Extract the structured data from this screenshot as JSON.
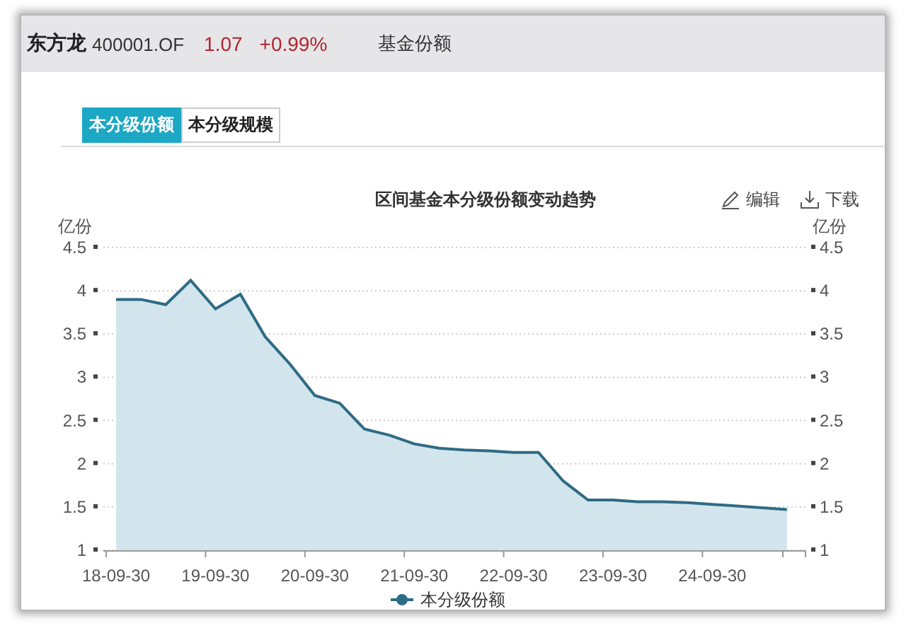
{
  "header": {
    "fund_name": "东方龙",
    "fund_code": "400001.OF",
    "price": "1.07",
    "change": "+0.99%",
    "section": "基金份额"
  },
  "tabs": [
    {
      "label": "本分级份额",
      "selected": true
    },
    {
      "label": "本分级规模",
      "selected": false
    }
  ],
  "chart_actions": [
    {
      "label": "编辑",
      "kind": "edit"
    },
    {
      "label": "下载",
      "kind": "download"
    }
  ],
  "chart_data": {
    "type": "area",
    "title": "区间基金本分级份额变动趋势",
    "ylabel": "亿份",
    "y2label": "亿份",
    "grid": true,
    "categories": [
      "18-09-30",
      null,
      null,
      null,
      "19-09-30",
      null,
      null,
      null,
      "20-09-30",
      null,
      null,
      null,
      "21-09-30",
      null,
      null,
      null,
      "22-09-30",
      null,
      null,
      null,
      "23-09-30",
      null,
      null,
      null,
      "24-09-30",
      null,
      null,
      null
    ],
    "series": [
      {
        "name": "本分级份额",
        "color": "#2e6b85",
        "values": [
          3.9,
          3.9,
          3.84,
          4.12,
          3.79,
          3.96,
          3.47,
          3.15,
          2.79,
          2.7,
          2.4,
          2.33,
          2.23,
          2.18,
          2.16,
          2.15,
          2.13,
          2.13,
          1.8,
          1.58,
          1.58,
          1.56,
          1.56,
          1.55,
          1.53,
          1.51,
          1.49,
          1.47
        ]
      }
    ],
    "yticks": [
      {
        "value": 1,
        "label": "1"
      },
      {
        "value": 1.5,
        "label": "1.5"
      },
      {
        "value": 2,
        "label": "2"
      },
      {
        "value": 2.5,
        "label": "2.5"
      },
      {
        "value": 3,
        "label": "3"
      },
      {
        "value": 3.5,
        "label": "3.5"
      },
      {
        "value": 4,
        "label": "4"
      },
      {
        "value": 4.5,
        "label": "4.5"
      }
    ],
    "ylim": [
      1,
      4.5
    ]
  }
}
